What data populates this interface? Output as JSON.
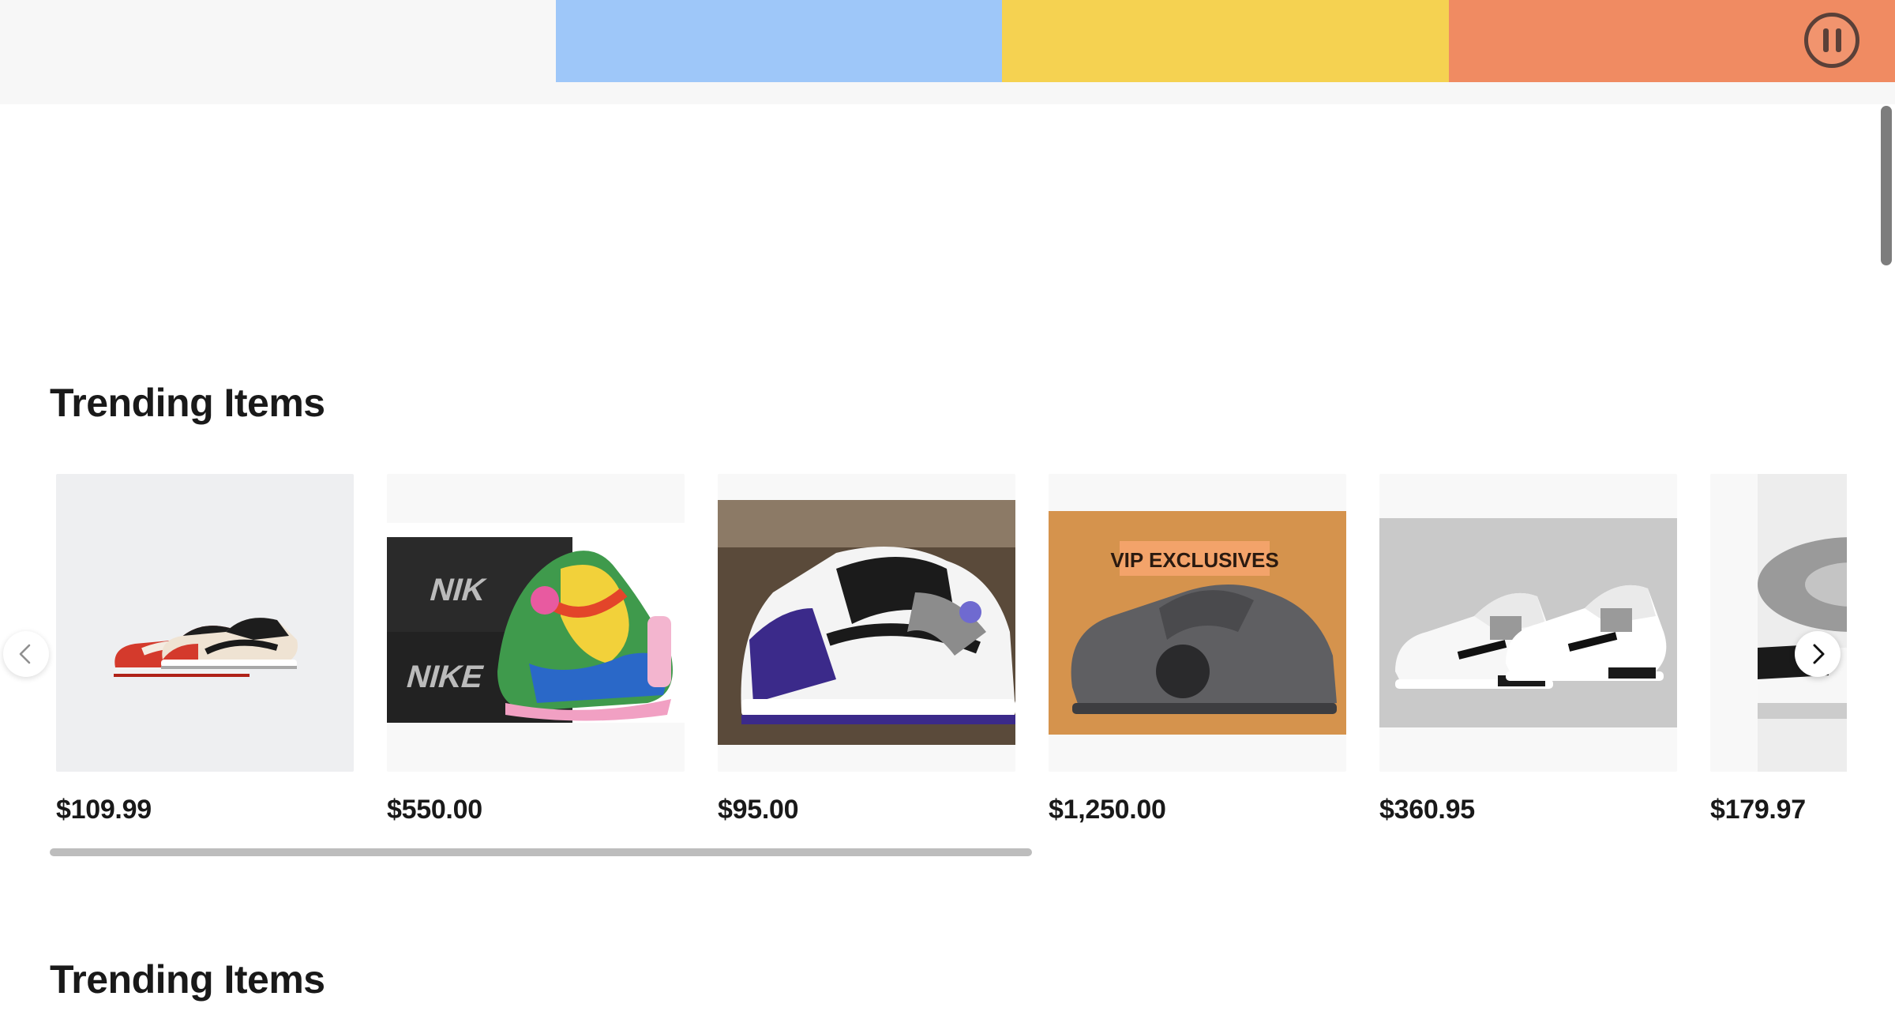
{
  "banner": {
    "colors": [
      "#f7f7f7",
      "#9ec7f9",
      "#f5d251",
      "#f08b62"
    ],
    "pause_icon": "pause-icon"
  },
  "sections": [
    {
      "title": "Trending Items",
      "items": [
        {
          "price": "$109.99",
          "image": "red-black-low-top-sneakers"
        },
        {
          "price": "$550.00",
          "image": "tie-dye-high-top-sneakers-with-boxes"
        },
        {
          "price": "$95.00",
          "image": "purple-black-high-top-sneaker-in-box"
        },
        {
          "price": "$1,250.00",
          "image": "grey-basketball-shoe-vip-exclusives"
        },
        {
          "price": "$360.95",
          "image": "white-black-sneakers-pair"
        },
        {
          "price": "$179.97",
          "image": "grey-sneaker-partial"
        }
      ],
      "image_label": "VIP EXCLUSIVES"
    },
    {
      "title": "Trending Items"
    }
  ],
  "icons": {
    "prev": "chevron-left-icon",
    "next": "chevron-right-icon"
  }
}
